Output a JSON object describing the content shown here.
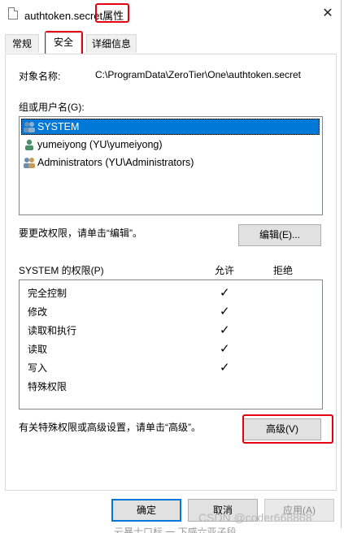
{
  "window": {
    "title_file": "authtoken.secret",
    "title_suffix": "属性",
    "close_glyph": "✕"
  },
  "tabs": [
    {
      "label": "常规",
      "active": false
    },
    {
      "label": "安全",
      "active": true
    },
    {
      "label": "详细信息",
      "active": false
    }
  ],
  "object": {
    "label": "对象名称:",
    "value": "C:\\ProgramData\\ZeroTier\\One\\authtoken.secret"
  },
  "groups": {
    "label": "组或用户名(G):",
    "items": [
      {
        "name": "SYSTEM",
        "icon": "group-users-icon",
        "selected": true
      },
      {
        "name": "yumeiyong (YU\\yumeiyong)",
        "icon": "user-icon",
        "selected": false
      },
      {
        "name": "Administrators (YU\\Administrators)",
        "icon": "group-users-icon",
        "selected": false
      }
    ]
  },
  "edit": {
    "hint": "要更改权限，请单击“编辑”。",
    "button": "编辑(E)..."
  },
  "permissions": {
    "header": "SYSTEM 的权限(P)",
    "allow_header": "允许",
    "deny_header": "拒绝",
    "rows": [
      {
        "name": "完全控制",
        "allow": true
      },
      {
        "name": "修改",
        "allow": true
      },
      {
        "name": "读取和执行",
        "allow": true
      },
      {
        "name": "读取",
        "allow": true
      },
      {
        "name": "写入",
        "allow": true
      },
      {
        "name": "特殊权限",
        "allow": false
      }
    ],
    "check_glyph": "✓"
  },
  "advanced": {
    "hint": "有关特殊权限或高级设置，请单击“高级”。",
    "button": "高级(V)"
  },
  "footer": {
    "ok": "确定",
    "cancel": "取消",
    "apply": "应用(A)"
  },
  "watermark": "CSDN @coder668868",
  "bottom_cut_text": "云暴士口标  一 下感六亚子段",
  "colors": {
    "highlight": "#e60012",
    "selection": "#0078d7"
  }
}
